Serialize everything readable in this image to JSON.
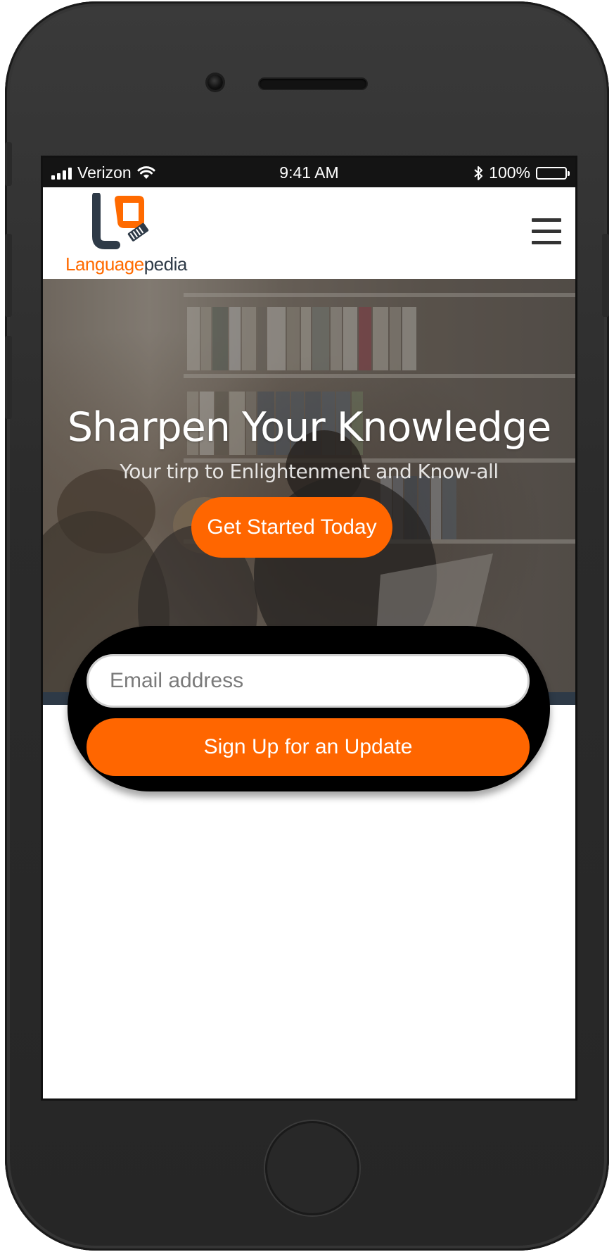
{
  "status_bar": {
    "carrier": "Verizon",
    "time": "9:41 AM",
    "battery": "100%",
    "signal_icon": "signal-bars-icon",
    "wifi_icon": "wifi-icon",
    "bluetooth_icon": "bluetooth-icon",
    "battery_icon": "battery-icon"
  },
  "header": {
    "logo_part1": "Language",
    "logo_part2": "pedia",
    "menu_icon": "hamburger-menu-icon"
  },
  "hero": {
    "title": "Sharpen Your Knowledge",
    "subtitle": "Your tirp to Enlightenment and Know-all",
    "cta_label": "Get Started Today"
  },
  "signup": {
    "email_placeholder": "Email address",
    "button_label": "Sign Up for an Update"
  },
  "colors": {
    "accent": "#ff6600",
    "logo_dark": "#2e3a47"
  }
}
